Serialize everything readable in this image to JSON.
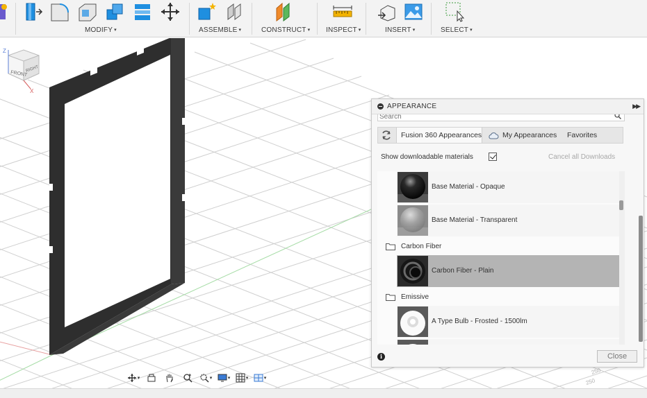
{
  "toolbar": {
    "groups": [
      {
        "label": "MODIFY"
      },
      {
        "label": "ASSEMBLE"
      },
      {
        "label": "CONSTRUCT"
      },
      {
        "label": "INSPECT"
      },
      {
        "label": "INSERT"
      },
      {
        "label": "SELECT"
      }
    ],
    "caret": "▾"
  },
  "viewcube": {
    "front": "FRONT",
    "right": "RIGHT",
    "axis_z": "Z",
    "axis_x": "X"
  },
  "panel": {
    "title": "APPEARANCE",
    "search_placeholder": "Search",
    "tabs": {
      "fusion": "Fusion 360 Appearances",
      "my": "My Appearances",
      "favorites": "Favorites"
    },
    "show_downloadable_label": "Show downloadable materials",
    "show_downloadable_checked": true,
    "cancel_downloads": "Cancel all Downloads",
    "list": {
      "items": [
        {
          "label": "Base Material - Opaque"
        },
        {
          "label": "Base Material - Transparent"
        },
        {
          "label": "Carbon Fiber - Plain"
        },
        {
          "label": "A Type Bulb - Frosted - 1500lm"
        }
      ],
      "folders": [
        {
          "label": "Carbon Fiber"
        },
        {
          "label": "Emissive"
        }
      ]
    },
    "close_label": "Close",
    "info": "i"
  },
  "colors": {
    "frame": "#2b2b2b",
    "grid": "#c9c9c9",
    "toolbar_blue": "#1f8fe0",
    "selected_row": "#b4b4b4"
  }
}
